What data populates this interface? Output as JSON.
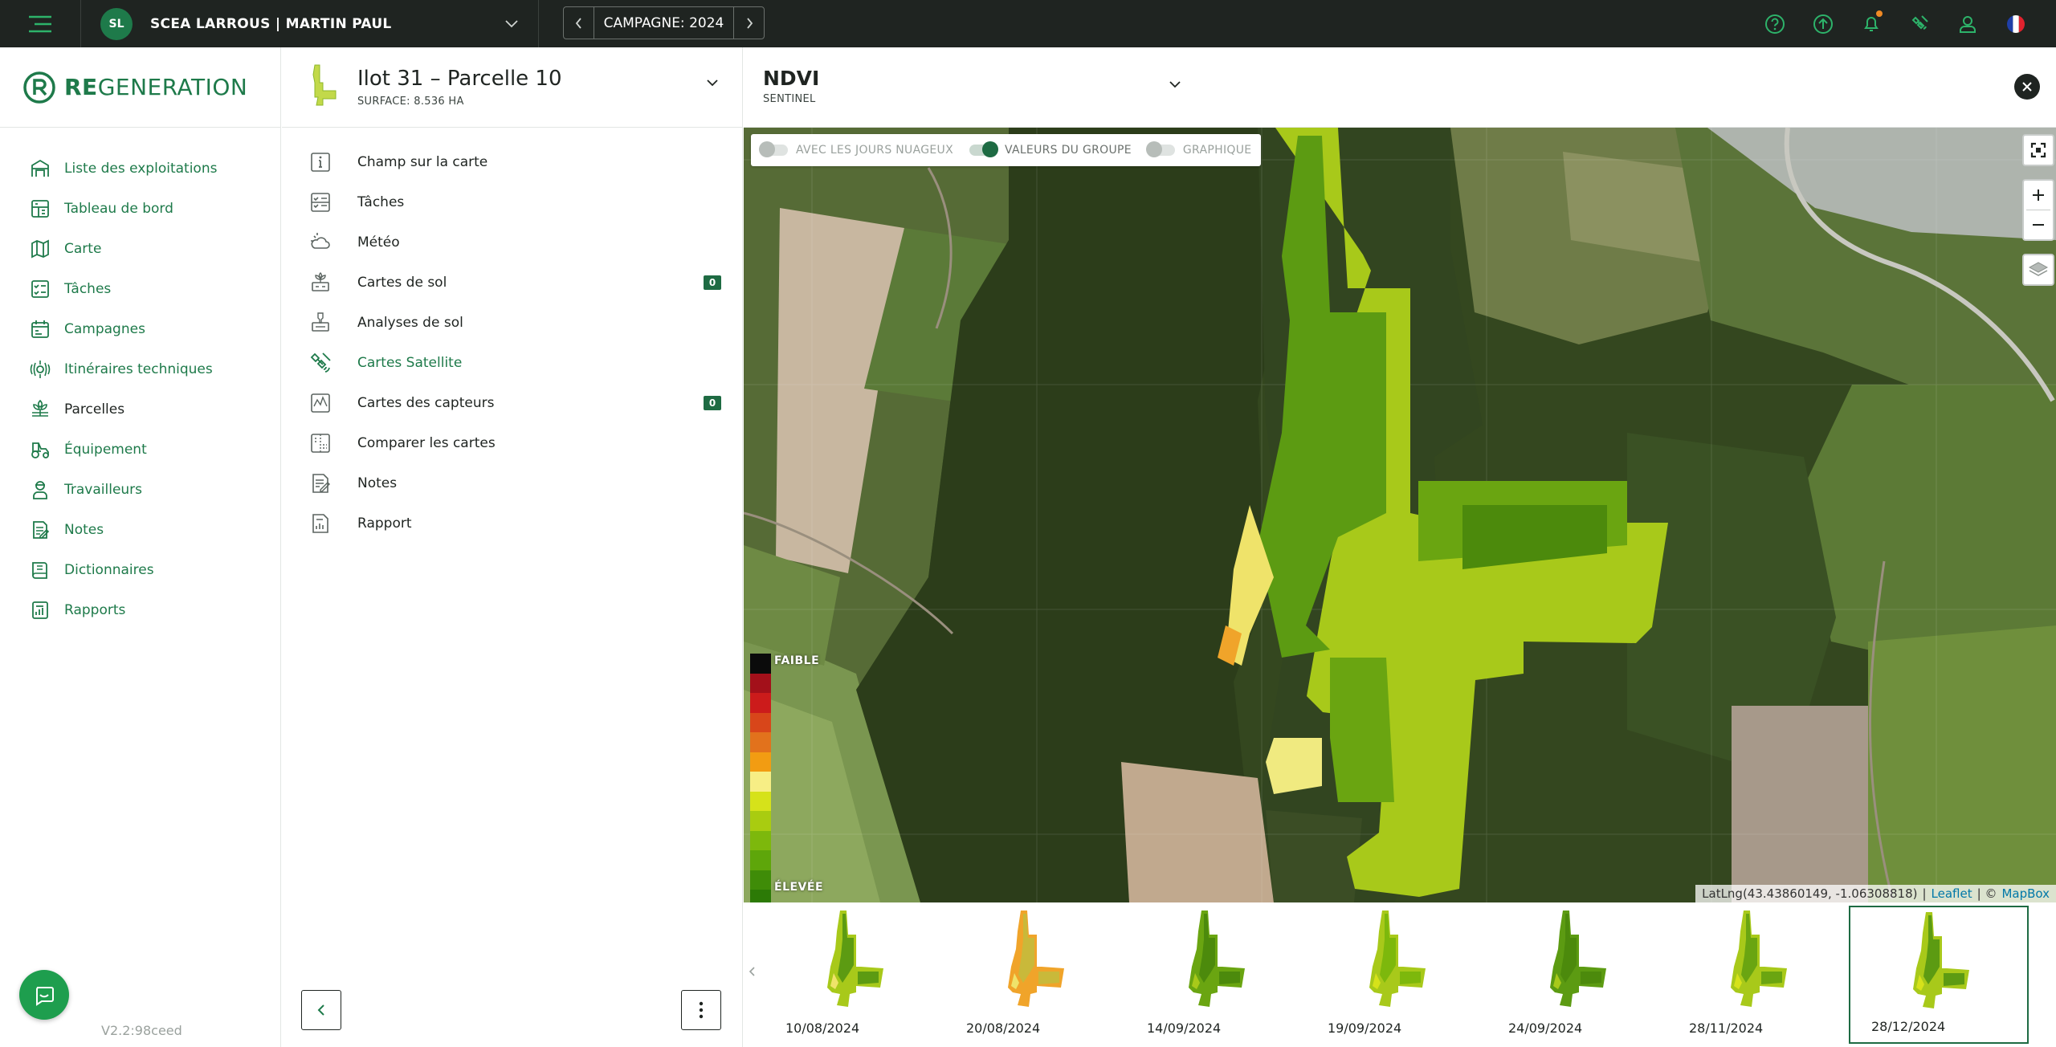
{
  "topbar": {
    "farm_initials": "SL",
    "farm_name": "SCEA LARROUS | MARTIN PAUL",
    "campaign_label": "CAMPAGNE: 2024"
  },
  "brand": {
    "logo_bold": "RE",
    "logo_rest": "GENERATION",
    "accent": "#1e7a4a"
  },
  "nav": {
    "items": [
      {
        "label": "Liste des exploitations",
        "icon": "farm-list-icon"
      },
      {
        "label": "Tableau de bord",
        "icon": "dashboard-icon"
      },
      {
        "label": "Carte",
        "icon": "map-icon"
      },
      {
        "label": "Tâches",
        "icon": "tasks-icon"
      },
      {
        "label": "Campagnes",
        "icon": "campaign-icon"
      },
      {
        "label": "Itinéraires techniques",
        "icon": "itinerary-icon"
      },
      {
        "label": "Parcelles",
        "icon": "parcels-icon",
        "active": true
      },
      {
        "label": "Équipement",
        "icon": "tractor-icon"
      },
      {
        "label": "Travailleurs",
        "icon": "worker-icon"
      },
      {
        "label": "Notes",
        "icon": "notes-icon"
      },
      {
        "label": "Dictionnaires",
        "icon": "dictionary-icon"
      },
      {
        "label": "Rapports",
        "icon": "reports-icon"
      }
    ],
    "version": "V2.2:98ceed"
  },
  "field": {
    "title": "Ilot 31 – Parcelle 10",
    "surface": "SURFACE: 8.536 HA",
    "menu": [
      {
        "label": "Champ sur la carte",
        "icon": "info-icon"
      },
      {
        "label": "Tâches",
        "icon": "tasks-icon"
      },
      {
        "label": "Météo",
        "icon": "weather-icon"
      },
      {
        "label": "Cartes de sol",
        "icon": "soil-map-icon",
        "badge": "0"
      },
      {
        "label": "Analyses de sol",
        "icon": "soil-analysis-icon"
      },
      {
        "label": "Cartes Satellite",
        "icon": "satellite-icon",
        "active": true
      },
      {
        "label": "Cartes des capteurs",
        "icon": "sensor-map-icon",
        "badge": "0"
      },
      {
        "label": "Comparer les cartes",
        "icon": "compare-icon"
      },
      {
        "label": "Notes",
        "icon": "notes-icon"
      },
      {
        "label": "Rapport",
        "icon": "report-icon"
      }
    ]
  },
  "map": {
    "layer_title": "NDVI",
    "layer_source": "SENTINEL",
    "toggles": [
      {
        "label": "AVEC LES JOURS NUAGEUX",
        "on": false
      },
      {
        "label": "VALEURS DU GROUPE",
        "on": true
      },
      {
        "label": "GRAPHIQUE",
        "on": false
      }
    ],
    "legend_low": "FAIBLE",
    "legend_high": "ÉLEVÉE",
    "legend_colors": [
      "#0b0b0b",
      "#a3101a",
      "#cc1b1b",
      "#d8461a",
      "#e2721c",
      "#f29c12",
      "#f7ee85",
      "#d6e21a",
      "#a9cc10",
      "#7db80c",
      "#5ea60a",
      "#3f8c08",
      "#2c7a06"
    ],
    "attribution_coords": "LatLng(43.43860149, -1.06308818)",
    "attribution_leaflet": "Leaflet",
    "attribution_sep": "| ©",
    "attribution_mapbox": "MapBox",
    "attribution_bar": "|"
  },
  "timeline": {
    "dates": [
      "10/08/2024",
      "20/08/2024",
      "14/09/2024",
      "19/09/2024",
      "24/09/2024",
      "28/11/2024",
      "28/12/2024"
    ],
    "selected_index": 6
  }
}
